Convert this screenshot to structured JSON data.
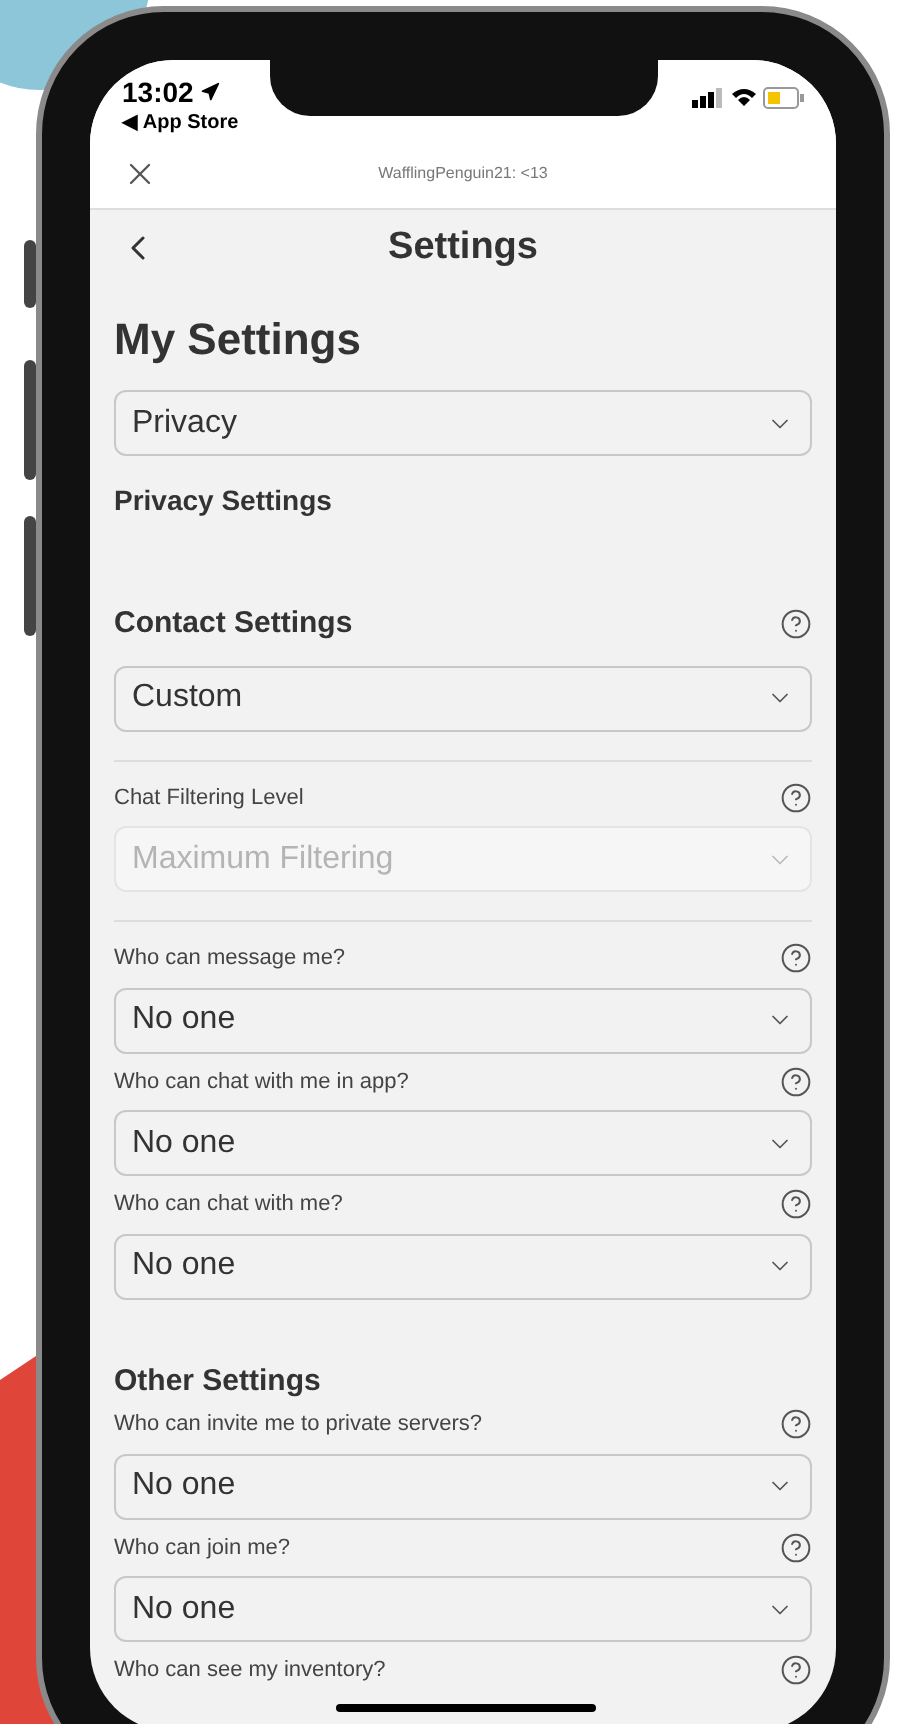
{
  "status_bar": {
    "time": "13:02",
    "back_app": "◀ App Store"
  },
  "header": {
    "title": "WafflingPenguin21: <13"
  },
  "nav": {
    "title": "Settings"
  },
  "page_title": "My Settings",
  "category": {
    "value": "Privacy"
  },
  "subtitle": "Privacy Settings",
  "sections": [
    {
      "title": "Contact Settings",
      "value": "Custom",
      "fields": [
        {
          "label": "Chat Filtering Level",
          "value": "Maximum Filtering",
          "disabled": true
        },
        {
          "label": "Who can message me?",
          "value": "No one",
          "disabled": false
        },
        {
          "label": "Who can chat with me in app?",
          "value": "No one",
          "disabled": false
        },
        {
          "label": "Who can chat with me?",
          "value": "No one",
          "disabled": false
        }
      ]
    },
    {
      "title": "Other Settings",
      "fields": [
        {
          "label": "Who can invite me to private servers?",
          "value": "No one",
          "disabled": false
        },
        {
          "label": "Who can join me?",
          "value": "No one",
          "disabled": false
        },
        {
          "label": "Who can see my inventory?",
          "disabled": false
        }
      ]
    }
  ]
}
